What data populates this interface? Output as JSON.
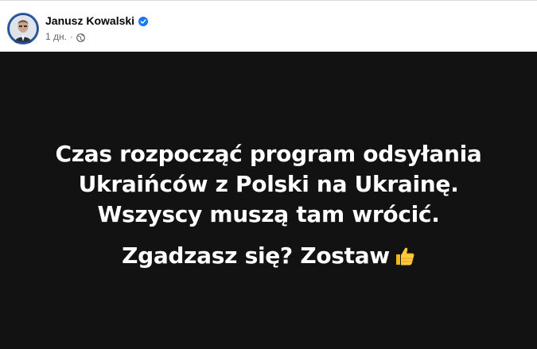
{
  "post": {
    "author": "Janusz Kowalski",
    "timestamp": "1 дн.",
    "separator": "·",
    "privacy_icon": "globe-icon",
    "verified_icon": "verified-badge-icon",
    "avatar_icon": "avatar",
    "text_line_1": "Czas rozpocząć program odsyłania Ukraińców z Polski na Ukrainę. Wszyscy muszą tam wrócić.",
    "text_line_2": "Zgadzasz się? Zostaw",
    "emoji": "thumbs-up-icon",
    "colors": {
      "background": "#121212",
      "text": "#ffffff",
      "verified": "#1877f2",
      "meta": "#65676b"
    }
  }
}
